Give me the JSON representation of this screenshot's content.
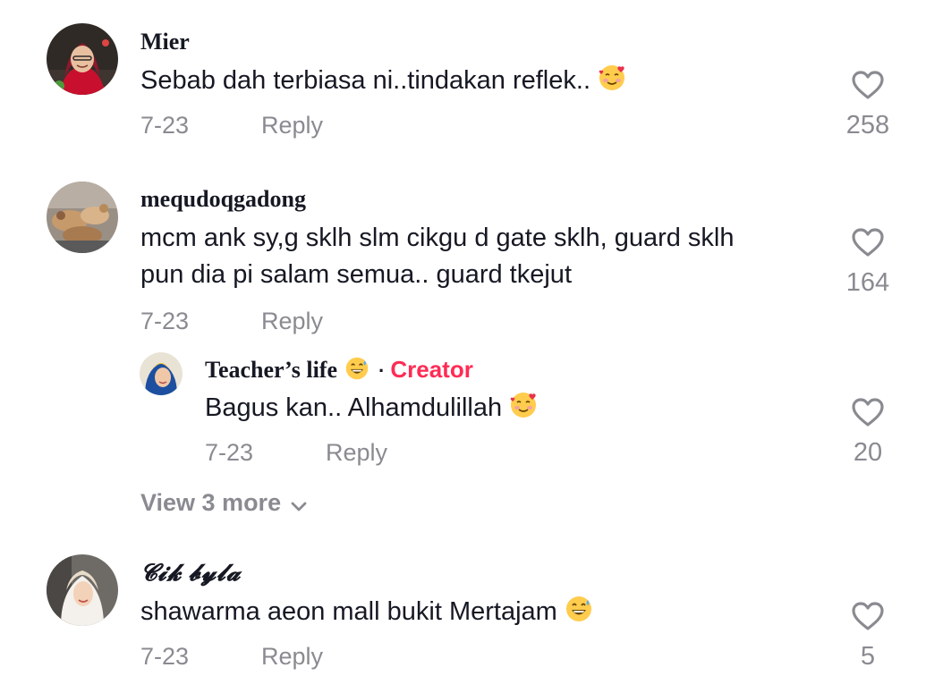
{
  "comments": [
    {
      "author": "Mier",
      "text": "Sebab dah terbiasa ni..tindakan reflek..",
      "emoji": "smiling-face-with-hearts",
      "date": "7-23",
      "reply_label": "Reply",
      "likes": "258"
    },
    {
      "author": "mequdoqgadong",
      "text_lines": [
        "mcm ank sy,g sklh slm cikgu d gate sklh, guard sklh",
        "pun dia pi salam semua.. guard tkejut"
      ],
      "date": "7-23",
      "reply_label": "Reply",
      "likes": "164",
      "replies": [
        {
          "author": "Teacher’s life",
          "author_emoji": "grinning-face-with-sweat",
          "separator": "·",
          "badge": "Creator",
          "text": "Bagus kan.. Alhamdulillah",
          "emoji": "smiling-face-with-hearts",
          "date": "7-23",
          "reply_label": "Reply",
          "likes": "20"
        }
      ],
      "view_more_label": "View 3 more"
    },
    {
      "author": "𝓒𝓲𝓴 𝓫𝔂𝓵𝓪",
      "text": "shawarma aeon mall bukit Mertajam",
      "emoji": "grinning-face-with-sweat",
      "date": "7-23",
      "reply_label": "Reply",
      "likes": "5"
    }
  ],
  "colors": {
    "text": "#161823",
    "muted": "#8a8b91",
    "creator": "#fe2c55"
  }
}
